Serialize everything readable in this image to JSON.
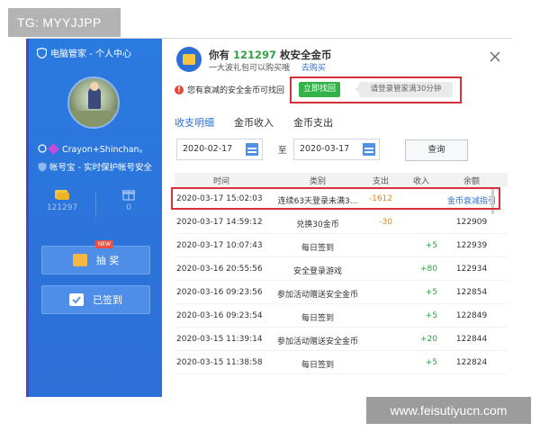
{
  "overlay": {
    "tg_label": "TG: MYYJJPP",
    "watermark": "www.feisutiyucn.com"
  },
  "sidebar": {
    "title": "电脑管家 - 个人中心",
    "username": "Crayon+Shinchan。",
    "account_status": "帐号宝 - 实时保护帐号安全",
    "stats": [
      {
        "icon": "coin-stack-icon",
        "value": "121297"
      },
      {
        "icon": "gift-icon",
        "value": "0"
      }
    ],
    "buttons": {
      "lottery": "抽 奖",
      "lottery_badge": "NEW",
      "signed": "已签到"
    }
  },
  "header": {
    "line1_prefix": "你有",
    "coins": "121297",
    "line1_suffix": "枚安全金币",
    "line2": "一大波礼包可以购买哦",
    "buy_link": "去购买"
  },
  "notice": {
    "text": "您有衰减的安全金币可找回",
    "retrieve_button": "立即找回",
    "tip": "请登录管家满30分钟"
  },
  "tabs": [
    {
      "label": "收支明细",
      "active": true
    },
    {
      "label": "金币收入",
      "active": false
    },
    {
      "label": "金币支出",
      "active": false
    }
  ],
  "filter": {
    "start_date": "2020-02-17",
    "to_label": "至",
    "end_date": "2020-03-17",
    "query_button": "查询"
  },
  "table": {
    "headers": [
      "时间",
      "类别",
      "支出",
      "收入",
      "余额"
    ],
    "rows": [
      {
        "time": "2020-03-17 15:02:03",
        "category": "连续63天登录未满3...",
        "expense": "-1612",
        "income": "",
        "balance": "金币衰减指引",
        "balance_is_link": true
      },
      {
        "time": "2020-03-17 14:59:12",
        "category": "兑换30金币",
        "expense": "-30",
        "income": "",
        "balance": "122909"
      },
      {
        "time": "2020-03-17 10:07:43",
        "category": "每日签到",
        "expense": "",
        "income": "+5",
        "balance": "122939"
      },
      {
        "time": "2020-03-16 20:55:56",
        "category": "安全登录游戏",
        "expense": "",
        "income": "+80",
        "balance": "122934"
      },
      {
        "time": "2020-03-16 09:23:56",
        "category": "参加活动赠送安全金币",
        "expense": "",
        "income": "+5",
        "balance": "122854"
      },
      {
        "time": "2020-03-16 09:23:54",
        "category": "每日签到",
        "expense": "",
        "income": "+5",
        "balance": "122849"
      },
      {
        "time": "2020-03-15 11:39:14",
        "category": "参加活动赠送安全金币",
        "expense": "",
        "income": "+20",
        "balance": "122844"
      },
      {
        "time": "2020-03-15 11:38:58",
        "category": "每日签到",
        "expense": "",
        "income": "+5",
        "balance": "122824"
      }
    ]
  },
  "colors": {
    "sidebar_blue": "#2c6fd6",
    "coin_green": "#31a046",
    "expense_orange": "#e08a1e",
    "highlight_red": "#d7303a",
    "retrieve_green": "#34b24a"
  }
}
